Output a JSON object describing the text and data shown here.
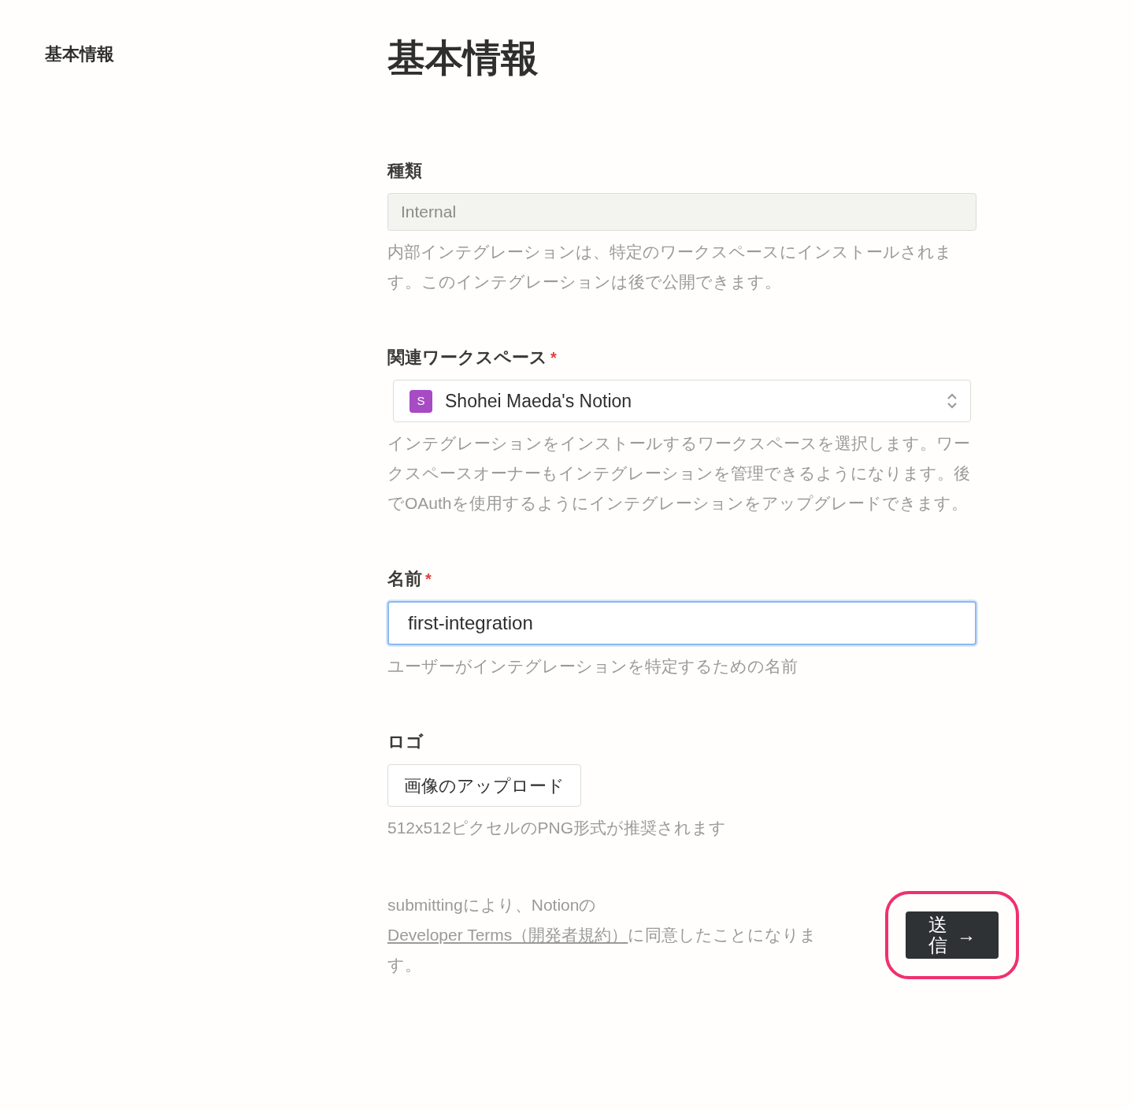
{
  "sidebar": {
    "items": [
      {
        "label": "基本情報",
        "selected": true
      }
    ]
  },
  "title": "基本情報",
  "fields": [
    {
      "kind": "readonly",
      "label": "種類",
      "value": "Internal",
      "help": "内部インテグレーションは、特定のワークスペースにインストールされます。このインテグレーションは後で公開できます。"
    },
    {
      "kind": "select",
      "label": "関連ワークスペース",
      "required_mark": "*",
      "value": "Shohei Maeda's Notion",
      "badge": "S",
      "color": "#a64bc4",
      "help": "インテグレーションをインストールするワークスペースを選択します。ワークスペースオーナーもインテグレーションを管理できるようになります。後でOAuthを使用するようにインテグレーションをアップグレードできます。"
    },
    {
      "kind": "input",
      "label": "名前",
      "required_mark": "*",
      "value": "first-integration",
      "focused": true,
      "help": "ユーザーがインテグレーションを特定するための名前"
    },
    {
      "kind": "upload",
      "label": "ロゴ",
      "button": "画像のアップロード",
      "help": "512x512ピクセルのPNG形式が推奨されます"
    }
  ],
  "footer": {
    "before": "submittingにより、Notionの",
    "link": "Developer Terms（開発者規約）",
    "after": "に同意したことになります。",
    "submit": "送信",
    "submit_icon": "→",
    "highlighted": true
  }
}
